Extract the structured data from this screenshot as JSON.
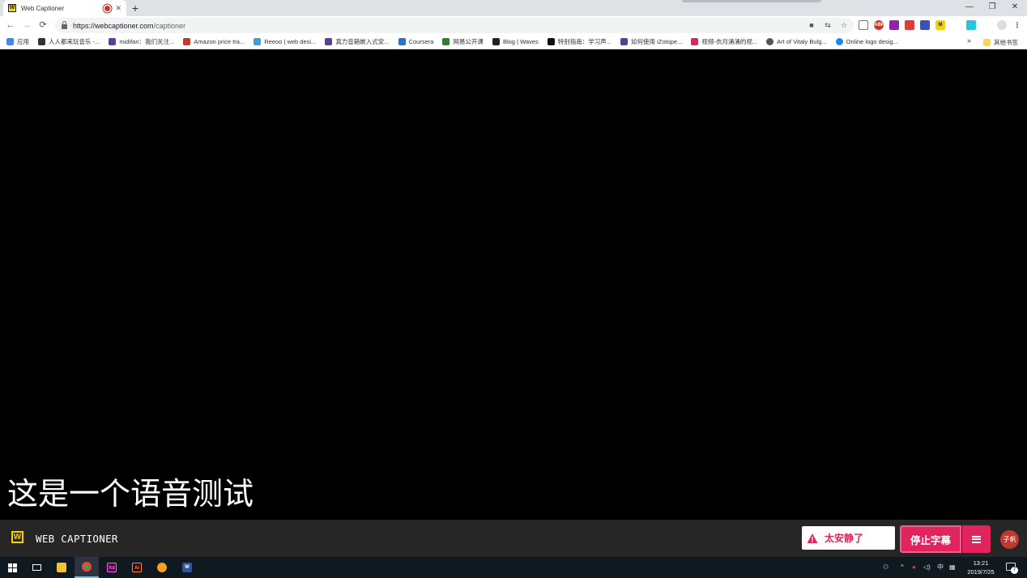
{
  "browser": {
    "tab": {
      "favicon_letter": "W",
      "title": "Web Captioner"
    },
    "new_tab_label": "+",
    "window_controls": {
      "minimize": "—",
      "maximize": "❐",
      "close": "✕"
    },
    "nav": {
      "back": "←",
      "forward": "→",
      "reload": "⟳"
    },
    "url": {
      "base": "https://webcaptioner.com",
      "path": "/captioner"
    },
    "ext_labels": [
      "",
      "",
      "ABP",
      "",
      "",
      "M",
      "",
      "",
      ""
    ],
    "bookmarks": [
      {
        "label": "应用",
        "color": "#4285f4"
      },
      {
        "label": "人人都来玩音乐 -...",
        "color": "#333333"
      },
      {
        "label": "midifan：我们关注...",
        "color": "#5c3d99"
      },
      {
        "label": "Amazon price tra...",
        "color": "#c0392b"
      },
      {
        "label": "Reeoo | web desi...",
        "color": "#3aa0d8"
      },
      {
        "label": "真力音箱嵌入式安...",
        "color": "#5c3d99"
      },
      {
        "label": "Coursera",
        "color": "#2a73cc"
      },
      {
        "label": "网易公开课",
        "color": "#2e7d32"
      },
      {
        "label": "Blog | Waves",
        "color": "#222222"
      },
      {
        "label": "特别指南：学习声...",
        "color": "#111111"
      },
      {
        "label": "如何使用 iZotope...",
        "color": "#5c3d99"
      },
      {
        "label": "视频-衣月涌涌的视...",
        "color": "#e91e63"
      },
      {
        "label": "Art of Vitaly Bulg...",
        "color": "#555555"
      },
      {
        "label": "Online logo desig...",
        "color": "#1e88e5"
      }
    ],
    "bookmarks_more": "»",
    "other_bookmarks": "其他书签"
  },
  "captioner": {
    "caption_text": "这是一个语音测试",
    "brand_letter": "W",
    "brand_name": "WEB CAPTIONER",
    "warning_text": "太安静了",
    "stop_button_label": "停止字幕",
    "avatar_text": "子帆"
  },
  "colors": {
    "accent": "#e0245e",
    "brand_yellow": "#f4d20e",
    "footer_bg": "#262626"
  },
  "taskbar": {
    "apps": [
      {
        "label": "",
        "color": "#f1c232"
      },
      {
        "label": "",
        "color": "#34a853"
      },
      {
        "label": "Xd",
        "color": "#470137"
      },
      {
        "label": "Ai",
        "color": "#330000"
      },
      {
        "label": "",
        "color": "#f4a21e"
      },
      {
        "label": "W",
        "color": "#2b579a"
      }
    ],
    "tray_ime": "中",
    "clock_time": "13:21",
    "clock_date": "2019/7/25",
    "notification_count": "7"
  }
}
